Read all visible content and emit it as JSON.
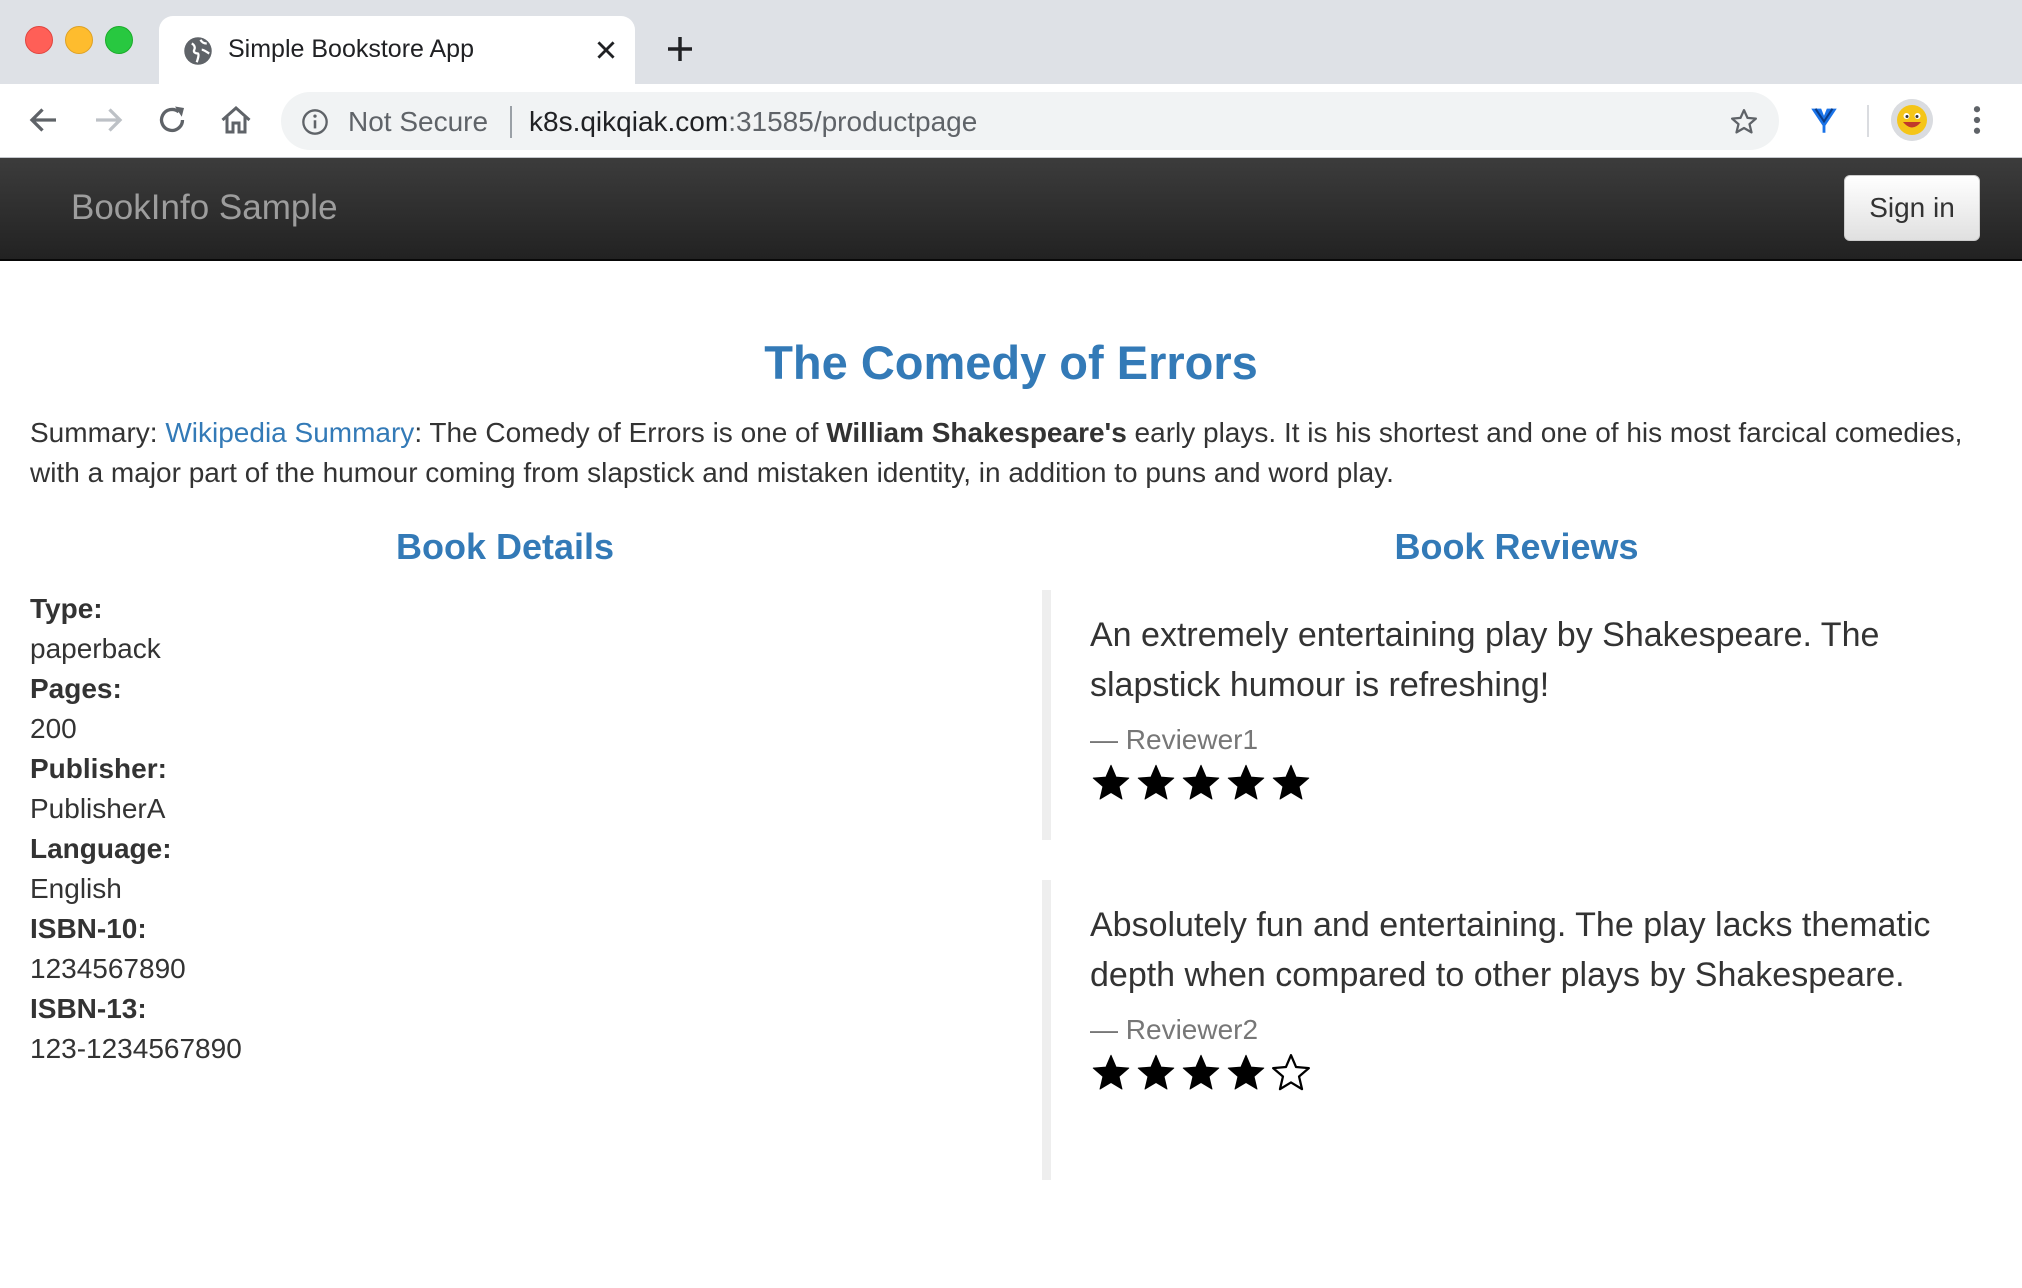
{
  "browser": {
    "tab_title": "Simple Bookstore App",
    "security_label": "Not Secure",
    "url_host": "k8s.qikqiak.com",
    "url_rest": ":31585/productpage"
  },
  "navbar": {
    "brand": "BookInfo Sample",
    "signin_label": "Sign in"
  },
  "book": {
    "title": "The Comedy of Errors",
    "summary_prefix": "Summary: ",
    "summary_link": "Wikipedia Summary",
    "summary_text_1": ": The Comedy of Errors is one of ",
    "summary_bold": "William Shakespeare's",
    "summary_text_2": " early plays. It is his shortest and one of his most farcical comedies, with a major part of the humour coming from slapstick and mistaken identity, in addition to puns and word play."
  },
  "details": {
    "heading": "Book Details",
    "items": [
      {
        "label": "Type:",
        "value": "paperback"
      },
      {
        "label": "Pages:",
        "value": "200"
      },
      {
        "label": "Publisher:",
        "value": "PublisherA"
      },
      {
        "label": "Language:",
        "value": "English"
      },
      {
        "label": "ISBN-10:",
        "value": "1234567890"
      },
      {
        "label": "ISBN-13:",
        "value": "123-1234567890"
      }
    ]
  },
  "reviews": {
    "heading": "Book Reviews",
    "items": [
      {
        "text": "An extremely entertaining play by Shakespeare. The slapstick humour is refreshing!",
        "reviewer": "— Reviewer1",
        "rating": 5,
        "max_rating": 5
      },
      {
        "text": "Absolutely fun and entertaining. The play lacks thematic depth when compared to other plays by Shakespeare.",
        "reviewer": "— Reviewer2",
        "rating": 4,
        "max_rating": 5
      }
    ]
  },
  "colors": {
    "link": "#337ab7",
    "navbar": "#222222",
    "brand": "#9d9d9d",
    "reviewer": "#777777"
  }
}
